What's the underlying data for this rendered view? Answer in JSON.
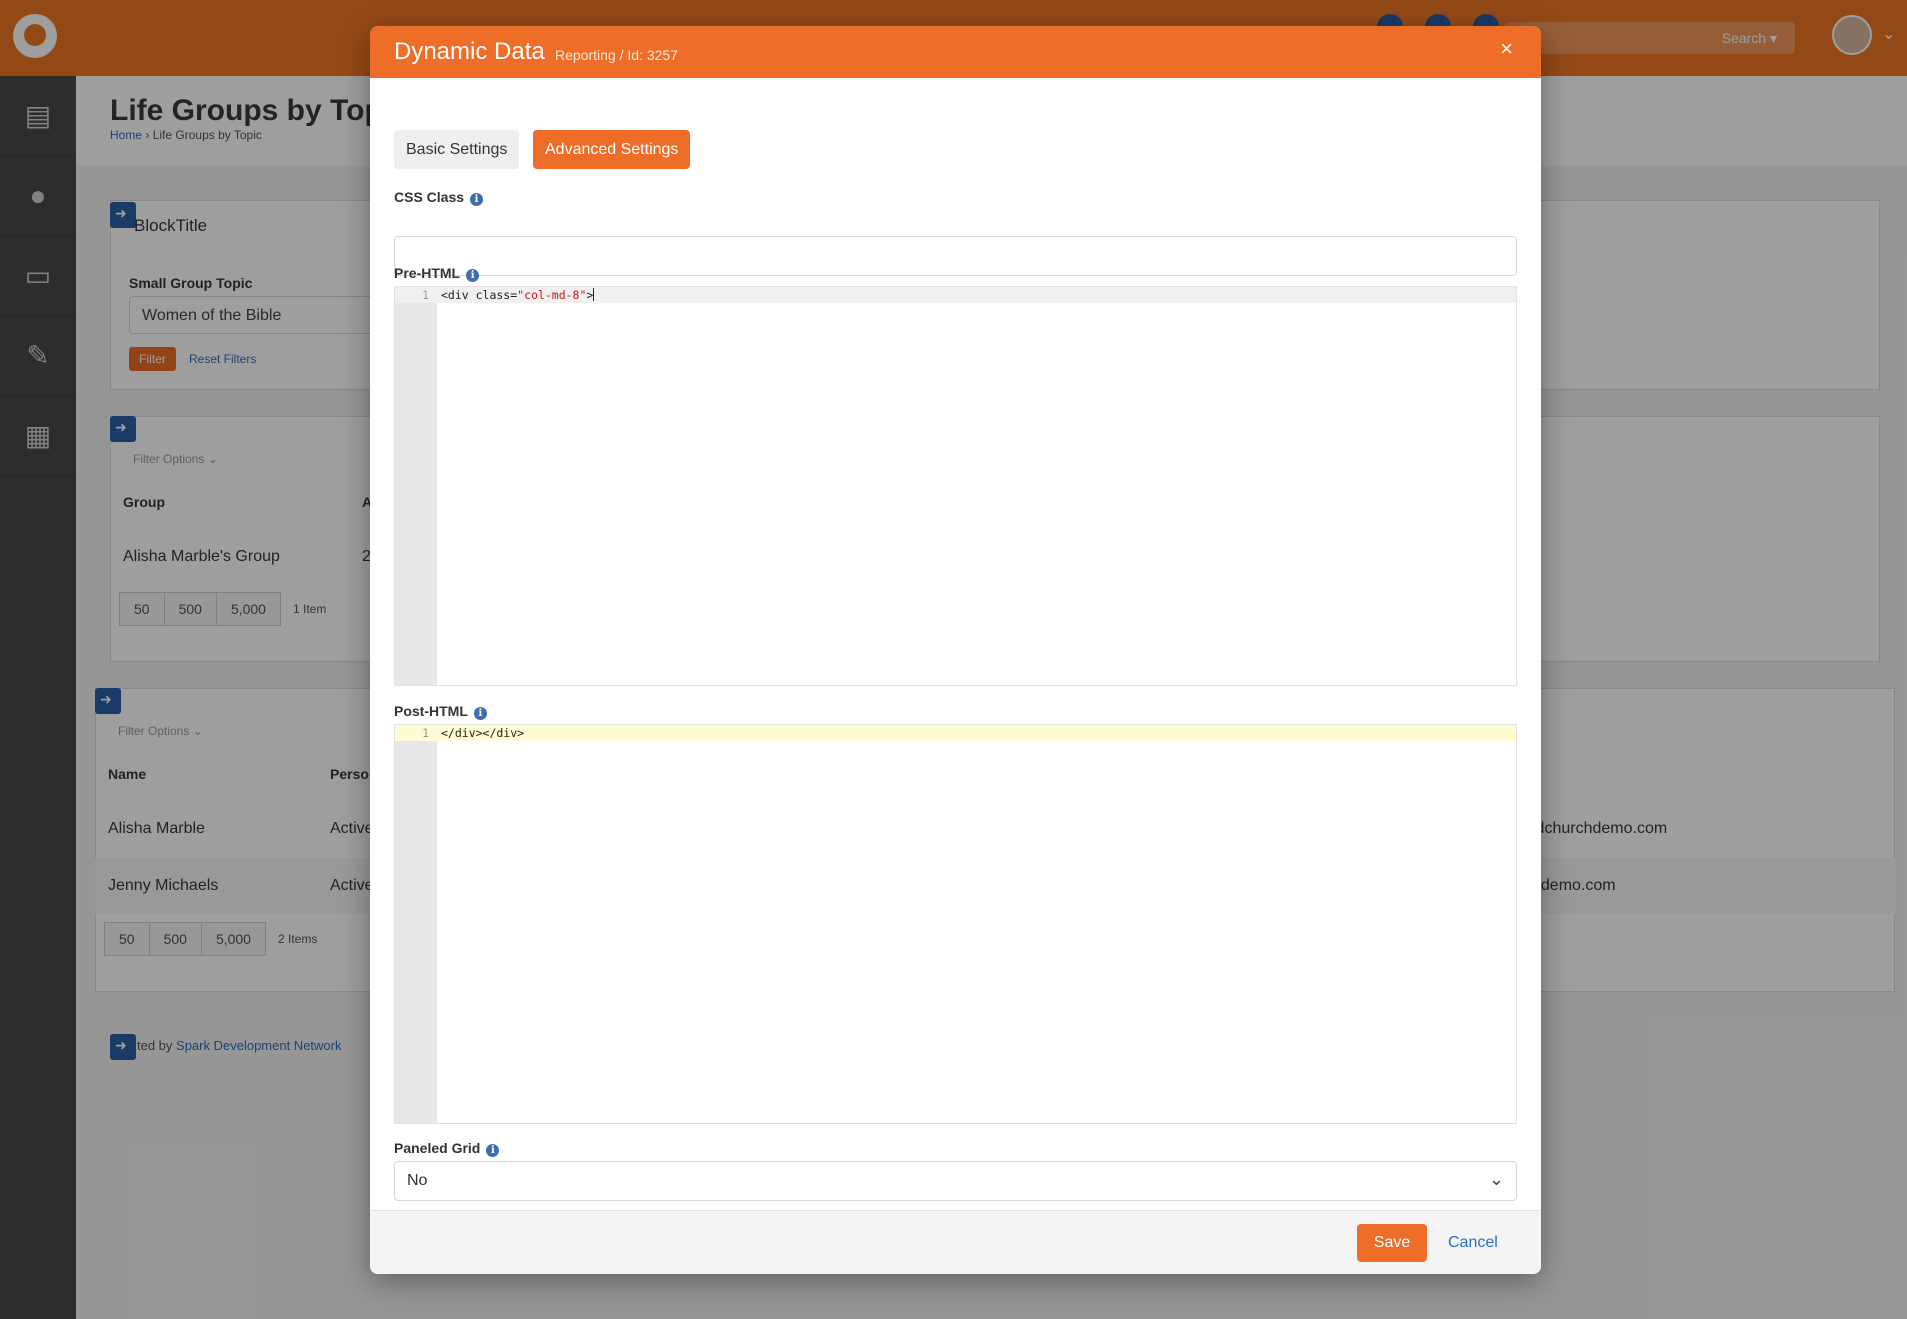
{
  "topbar": {
    "search_label": "Search ▾"
  },
  "page": {
    "title": "Life Groups by Topic",
    "breadcrumb": {
      "home": "Home",
      "separator": "›",
      "current": "Life Groups by Topic"
    }
  },
  "block1": {
    "title": "BlockTitle",
    "filter_label": "Small Group Topic",
    "filter_value": "Women of the Bible",
    "filter_button": "Filter",
    "reset_link": "Reset Filters"
  },
  "grid1": {
    "filter_options": "Filter Options ⌄",
    "col_group": "Group",
    "col_second": "A",
    "row_group": "Alisha Marble's Group",
    "row_second": "2",
    "pager": [
      "50",
      "500",
      "5,000"
    ],
    "count": "1 Item"
  },
  "grid2": {
    "filter_options": "Filter Options ⌄",
    "col_name": "Name",
    "col_person": "Perso",
    "rows": [
      {
        "name": "Alisha Marble",
        "status": "Active",
        "email": "idchurchdemo.com"
      },
      {
        "name": "Jenny Michaels",
        "status": "Active",
        "email": "hdemo.com"
      }
    ],
    "pager": [
      "50",
      "500",
      "5,000"
    ],
    "count": "2 Items"
  },
  "footer_credit": {
    "prefix": "ted by ",
    "link": "Spark Development Network"
  },
  "modal": {
    "title": "Dynamic Data",
    "subtitle": "Reporting / Id: 3257",
    "close_glyph": "×",
    "tabs": {
      "basic": "Basic Settings",
      "advanced": "Advanced Settings"
    },
    "css_class_label": "CSS Class",
    "css_class_value": "",
    "pre_html_label": "Pre-HTML",
    "pre_html": {
      "line": "1",
      "tag_open": "<div class=",
      "attr_value": "\"col-md-8\"",
      "tag_close": ">"
    },
    "post_html_label": "Post-HTML",
    "post_html": {
      "line": "1",
      "code": "</div></div>"
    },
    "paneled_grid_label": "Paneled Grid",
    "paneled_grid_value": "No",
    "save_label": "Save",
    "cancel_label": "Cancel"
  },
  "colors": {
    "brand_orange": "#ee6d28",
    "link_blue": "#2a70c2",
    "sidebar": "#4a4a4a"
  }
}
